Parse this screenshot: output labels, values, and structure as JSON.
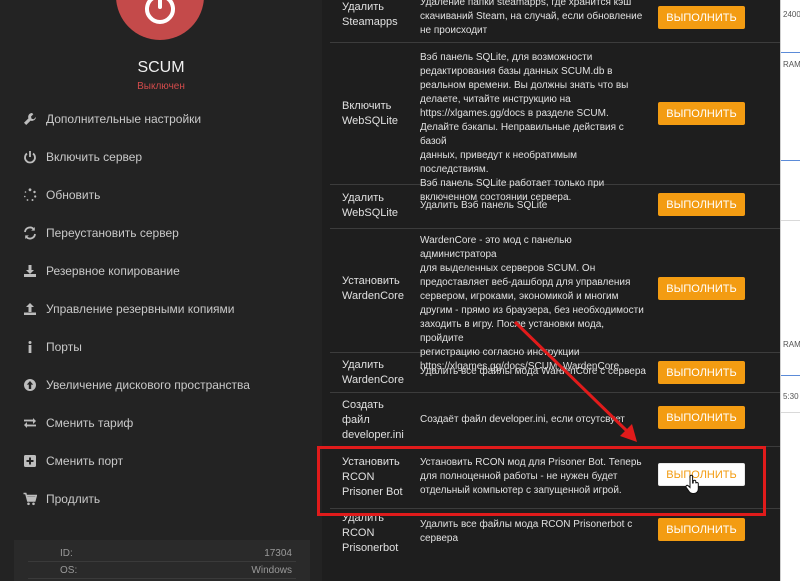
{
  "sidebar": {
    "server_name": "SCUM",
    "server_status": "Выключен",
    "status_color": "#d24b4b",
    "power_color": "#c44a4a",
    "menu": [
      {
        "label": "Дополнительные настройки",
        "icon": "wrench-icon"
      },
      {
        "label": "Включить сервер",
        "icon": "power-icon"
      },
      {
        "label": "Обновить",
        "icon": "spinner-icon"
      },
      {
        "label": "Переустановить сервер",
        "icon": "refresh-icon"
      },
      {
        "label": "Резервное копирование",
        "icon": "download-icon"
      },
      {
        "label": "Управление резервными копиями",
        "icon": "upload-icon"
      },
      {
        "label": "Порты",
        "icon": "info-icon"
      },
      {
        "label": "Увеличение дискового пространства",
        "icon": "arrow-up-circle-icon"
      },
      {
        "label": "Сменить тариф",
        "icon": "exchange-icon"
      },
      {
        "label": "Сменить порт",
        "icon": "plus-square-icon"
      },
      {
        "label": "Продлить",
        "icon": "cart-icon"
      }
    ],
    "info": {
      "id_label": "ID:",
      "id_value": "17304",
      "os_label": "OS:",
      "os_value": "Windows"
    }
  },
  "commands": {
    "button_label": "ВЫПОЛНИТЬ",
    "accent_color": "#f39c12",
    "rows": [
      {
        "name": [
          "Удалить",
          "Steamapps"
        ],
        "desc": [
          "Удаление папки steamapps, где хранится кэш",
          "скачиваний Steam, на случай, если обновление",
          "не происходит"
        ]
      },
      {
        "name": [
          "Включить",
          "WebSQLite"
        ],
        "desc": [
          "Вэб панель SQLite, для возможности",
          "редактирования базы данных SCUM.db в",
          "реальном времени. Вы должны знать что вы",
          "делаете, читайте инструкцию на",
          "https://xlgames.gg/docs в разделе SCUM.",
          "Делайте бэкапы. Неправильные действия с базой",
          "данных, приведут к необратимым последствиям.",
          "Вэб панель SQLite работает только при",
          "включенном состоянии сервера."
        ]
      },
      {
        "name": [
          "Удалить",
          "WebSQLite"
        ],
        "desc": [
          "Удалить Вэб панель SQLite"
        ]
      },
      {
        "name": [
          "Установить",
          "WardenCore"
        ],
        "desc": [
          "WardenCore - это мод с панелью администратора",
          "для выделенных серверов SCUM. Он",
          "предоставляет веб-дашборд для управления",
          "сервером, игроками, экономикой и многим",
          "другим - прямо из браузера, без необходимости",
          "заходить в игру. После установки мода, пройдите",
          "регистрацию согласно инструкции",
          "https://xlgames.gg/docs/SCUM_WardenCore"
        ]
      },
      {
        "name": [
          "Удалить",
          "WardenCore"
        ],
        "desc": [
          "Удалить все файлы мода WardenCore с сервера"
        ]
      },
      {
        "name": [
          "Создать",
          "файл",
          "developer.ini"
        ],
        "desc": [
          "Создаёт файл developer.ini, если отсутсвует"
        ]
      },
      {
        "name": [
          "Установить",
          "RCON",
          "Prisoner Bot"
        ],
        "desc": [
          "Установить RCON мод для Prisoner Bot. Теперь",
          "для полноценной работы - не нужен будет",
          "отдельный компьютер с запущенной игрой."
        ]
      },
      {
        "name": [
          "Удалить",
          "RCON",
          "Prisonerbot"
        ],
        "desc": [
          "Удалить все файлы мода RCON Prisonerbot с",
          "сервера"
        ]
      }
    ]
  },
  "background_app": {
    "texts": [
      "2400",
      "RAM",
      "RAM",
      "5:30"
    ]
  },
  "annotation": {
    "highlight_color": "#e01b1b"
  }
}
